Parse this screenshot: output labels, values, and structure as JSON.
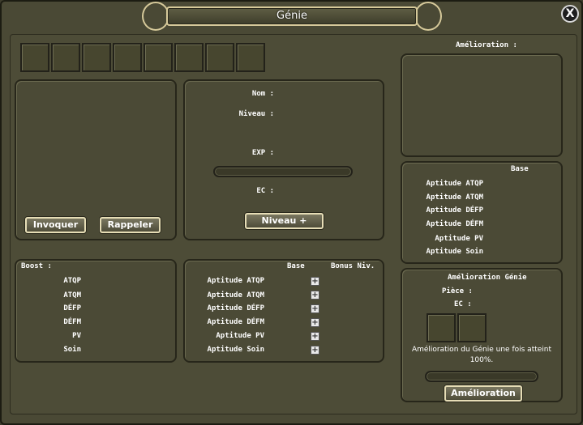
{
  "window": {
    "title": "Génie",
    "close_symbol": "X"
  },
  "summon": {
    "invoke_label": "Invoquer",
    "recall_label": "Rappeler"
  },
  "info": {
    "name_label": "Nom :",
    "level_label": "Niveau :",
    "exp_label": "EXP :",
    "ec_label": "EC :",
    "level_up_label": "Niveau +"
  },
  "boost": {
    "title": "Boost :",
    "items": [
      "ATQP",
      "ATQM",
      "DÉFP",
      "DÉFM",
      "PV",
      "Soin"
    ]
  },
  "aptitudes": {
    "base_header": "Base",
    "bonus_header": "Bonus Niv.",
    "items": [
      "Aptitude ATQP",
      "Aptitude ATQM",
      "Aptitude DÉFP",
      "Aptitude DÉFM",
      "Aptitude PV",
      "Aptitude Soin"
    ],
    "plus_symbol": "+"
  },
  "amelioration": {
    "title": "Amélioration :"
  },
  "base_panel": {
    "header": "Base",
    "items": [
      "Aptitude ATQP",
      "Aptitude ATQM",
      "Aptitude DÉFP",
      "Aptitude DÉFM",
      "Aptitude PV",
      "Aptitude Soin"
    ]
  },
  "upgrade": {
    "title": "Amélioration Génie",
    "piece_label": "Pièce :",
    "ec_label": "EC :",
    "message_line1": "Amélioration du Génie une fois atteint",
    "message_line2": "100%.",
    "button_label": "Amélioration"
  }
}
